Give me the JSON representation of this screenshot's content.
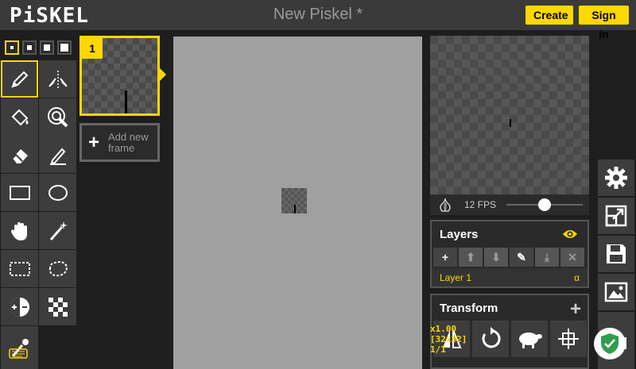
{
  "header": {
    "logo": "PiSKEL",
    "title": "New Piskel *",
    "create_label": "Create",
    "signin_label": "Sign in"
  },
  "tools": [
    {
      "name": "pen",
      "selected": true
    },
    {
      "name": "vertical-mirror-pen"
    },
    {
      "name": "paint-bucket"
    },
    {
      "name": "paint-all-similar"
    },
    {
      "name": "eraser"
    },
    {
      "name": "stroke"
    },
    {
      "name": "rectangle"
    },
    {
      "name": "circle"
    },
    {
      "name": "move"
    },
    {
      "name": "magic-wand"
    },
    {
      "name": "rectangle-select"
    },
    {
      "name": "lasso-select"
    },
    {
      "name": "lighten"
    },
    {
      "name": "dithering"
    },
    {
      "name": "color-picker"
    }
  ],
  "frames": {
    "items": [
      {
        "number": "1"
      }
    ],
    "add_label": "Add new frame"
  },
  "preview": {
    "fps_label": "12 FPS",
    "fps_slider_fraction": 0.5
  },
  "layers": {
    "title": "Layers",
    "items": [
      {
        "name": "Layer 1",
        "alpha": "α"
      }
    ]
  },
  "transform": {
    "title": "Transform"
  },
  "status": {
    "zoom": "x1.00",
    "size": "[32x32]",
    "frame": "1/1"
  },
  "colors": {
    "accent": "#ffd700",
    "panel": "#3d3d3d",
    "canvas_bg": "#a0a0a0"
  }
}
